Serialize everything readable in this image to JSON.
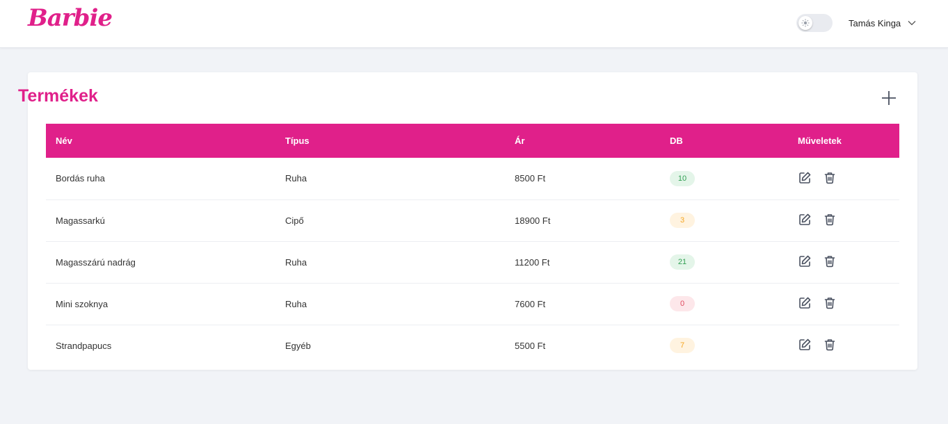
{
  "header": {
    "logo_text": "Barbie",
    "user_name": "Tamás Kinga",
    "icons": [
      "sun-icon",
      "chevron-down-icon"
    ]
  },
  "page": {
    "title": "Termékek",
    "add_icon": "plus-icon"
  },
  "table": {
    "columns": [
      "Név",
      "Típus",
      "Ár",
      "DB",
      "Műveletek"
    ],
    "rows": [
      {
        "name": "Bordás ruha",
        "type": "Ruha",
        "price": "8500 Ft",
        "qty": "10",
        "qty_status": "green"
      },
      {
        "name": "Magassarkú",
        "type": "Cipő",
        "price": "18900 Ft",
        "qty": "3",
        "qty_status": "orange"
      },
      {
        "name": "Magasszárú nadrág",
        "type": "Ruha",
        "price": "11200 Ft",
        "qty": "21",
        "qty_status": "green"
      },
      {
        "name": "Mini szoknya",
        "type": "Ruha",
        "price": "7600 Ft",
        "qty": "0",
        "qty_status": "red"
      },
      {
        "name": "Strandpapucs",
        "type": "Egyéb",
        "price": "5500 Ft",
        "qty": "7",
        "qty_status": "orange"
      }
    ],
    "row_action_icons": [
      "edit-icon",
      "trash-icon"
    ]
  },
  "colors": {
    "brand": "#e0208a",
    "background": "#f1f3f7",
    "stock_ok": "#2f9e51",
    "stock_low": "#f5a623",
    "stock_empty": "#e04a5f"
  }
}
